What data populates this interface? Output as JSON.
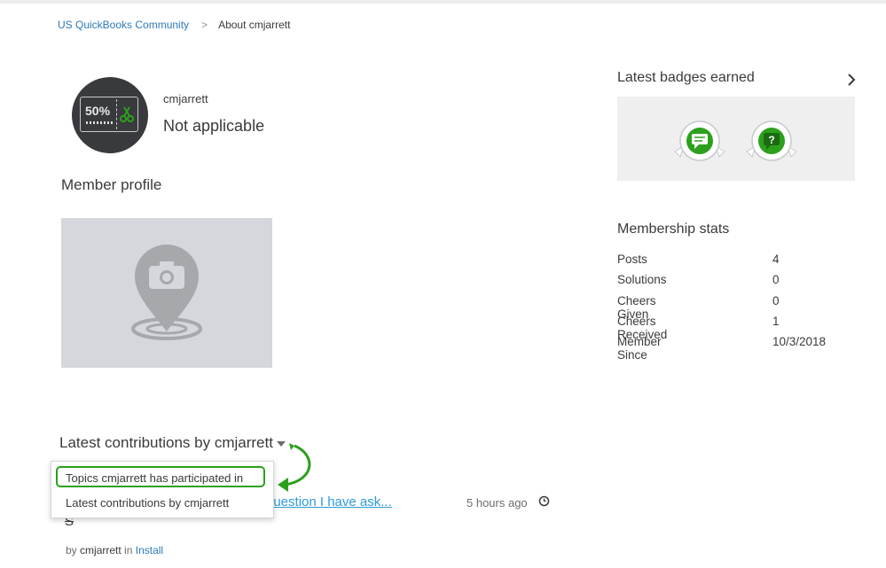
{
  "breadcrumb": {
    "community": "US QuickBooks Community",
    "separator": ">",
    "current": "About cmjarrett"
  },
  "profile": {
    "avatar_text": "50%",
    "username": "cmjarrett",
    "rank": "Not applicable",
    "member_profile_title": "Member profile"
  },
  "badges": {
    "title": "Latest badges earned",
    "icons": [
      "speech-bubble-badge-icon",
      "question-bubble-badge-icon"
    ],
    "badge_question_mark": "?"
  },
  "stats": {
    "title": "Membership stats",
    "rows": [
      {
        "label": "Posts",
        "value": "4"
      },
      {
        "label": "Solutions",
        "value": "0"
      },
      {
        "label": "Cheers Given",
        "value": "0"
      },
      {
        "label": "Cheers Received",
        "value": "1"
      },
      {
        "label": "Member Since",
        "value": "10/3/2018"
      }
    ]
  },
  "contributions": {
    "title": "Latest contributions by cmjarrett",
    "dropdown_options": [
      "Topics cmjarrett has participated in",
      "Latest contributions by cmjarrett"
    ],
    "post": {
      "title_fragment": "question I have ask...",
      "time": "5 hours ago",
      "second_line": "S",
      "by_label": "by",
      "author": "cmjarrett",
      "in_label": "in",
      "board": "Install"
    }
  },
  "colors": {
    "link": "#2d7ab8",
    "accent_green": "#2ca01c",
    "text": "#393a3d"
  }
}
